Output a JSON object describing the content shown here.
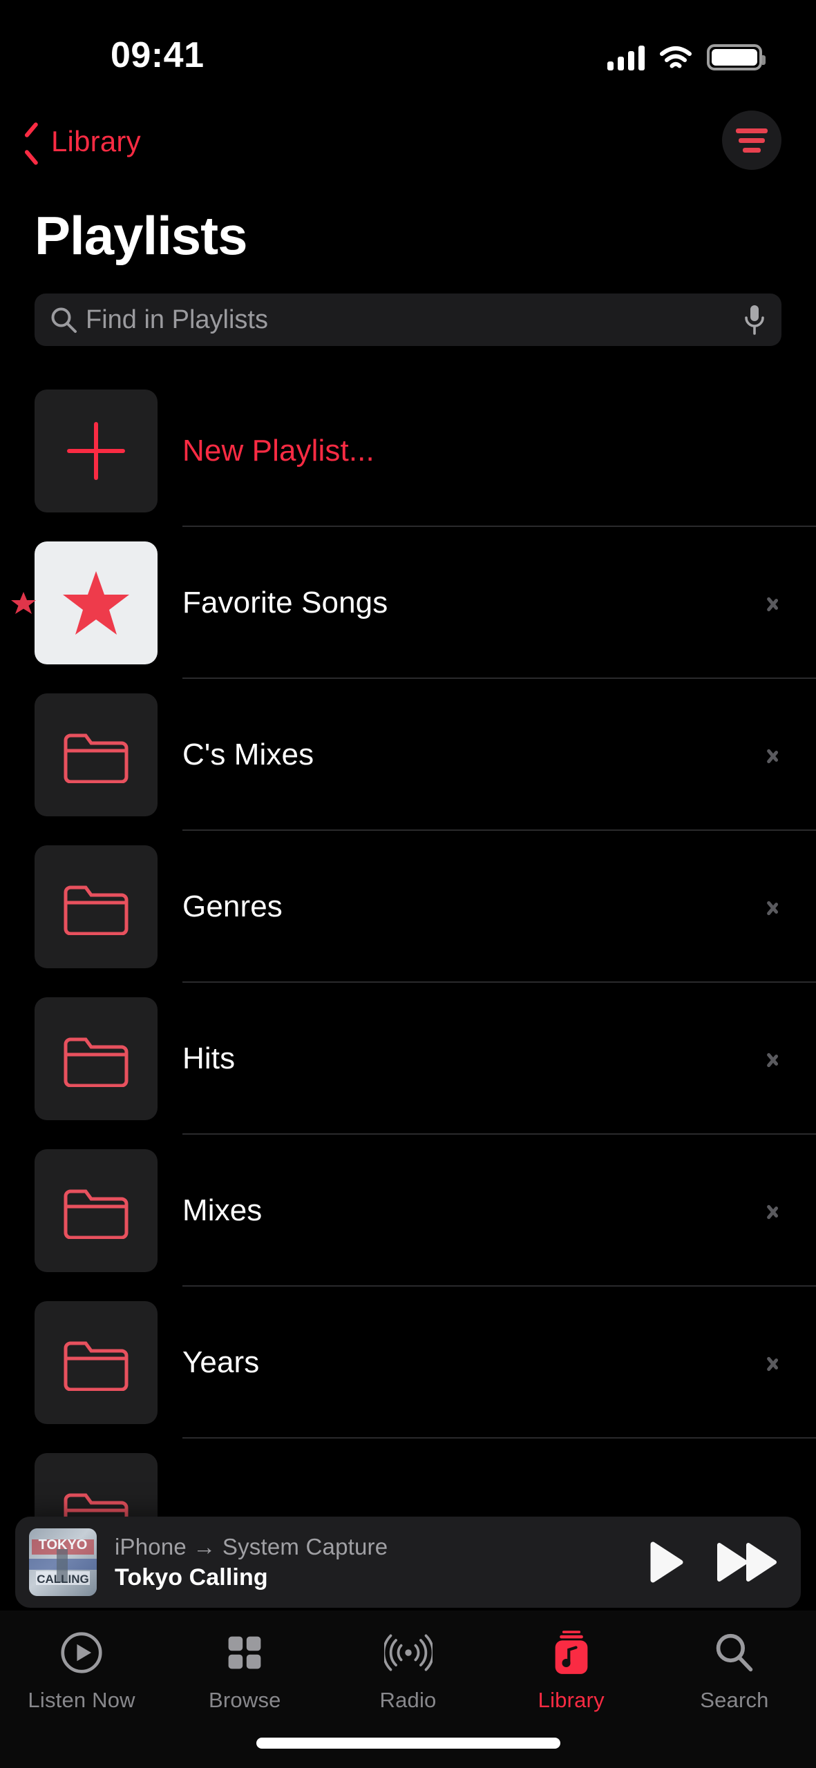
{
  "theme": {
    "accent": "#FA2B43",
    "background": "#000000",
    "tile_bg": "#1f1f20",
    "tile_white": "#eceef0",
    "separator": "#2a2a2c",
    "secondary_text": "#9b9b9f"
  },
  "status_bar": {
    "time": "09:41",
    "cellular_icon": "cellular-signal-icon",
    "wifi_icon": "wifi-icon",
    "battery_icon": "battery-full-icon"
  },
  "nav": {
    "back_label": "Library",
    "back_icon": "chevron-left-icon",
    "filter_icon": "sort-filter-icon"
  },
  "page_title": "Playlists",
  "search": {
    "placeholder": "Find in Playlists",
    "value": "",
    "search_icon": "search-icon",
    "mic_icon": "microphone-icon"
  },
  "list": [
    {
      "label": "New Playlist...",
      "icon": "plus-icon",
      "style": "accent",
      "tile": "dark",
      "chevron": false,
      "edge_marker": false
    },
    {
      "label": "Favorite Songs",
      "icon": "star-icon",
      "style": "normal",
      "tile": "white",
      "chevron": true,
      "edge_marker": true
    },
    {
      "label": "C's Mixes",
      "icon": "folder-icon",
      "style": "normal",
      "tile": "dark",
      "chevron": true,
      "edge_marker": false
    },
    {
      "label": "Genres",
      "icon": "folder-icon",
      "style": "normal",
      "tile": "dark",
      "chevron": true,
      "edge_marker": false
    },
    {
      "label": "Hits",
      "icon": "folder-icon",
      "style": "normal",
      "tile": "dark",
      "chevron": true,
      "edge_marker": false
    },
    {
      "label": "Mixes",
      "icon": "folder-icon",
      "style": "normal",
      "tile": "dark",
      "chevron": true,
      "edge_marker": false
    },
    {
      "label": "Years",
      "icon": "folder-icon",
      "style": "normal",
      "tile": "dark",
      "chevron": true,
      "edge_marker": false
    },
    {
      "label": "",
      "icon": "folder-icon",
      "style": "normal",
      "tile": "dark",
      "chevron": false,
      "edge_marker": false
    }
  ],
  "mini_player": {
    "route": "iPhone → System Capture",
    "title": "Tokyo Calling",
    "artwork_text": "TOKYO CALLING",
    "artwork_name": "album-artwork",
    "play_icon": "play-icon",
    "forward_icon": "fast-forward-icon"
  },
  "tabs": [
    {
      "label": "Listen Now",
      "icon": "play-circle-icon",
      "active": false
    },
    {
      "label": "Browse",
      "icon": "grid-icon",
      "active": false
    },
    {
      "label": "Radio",
      "icon": "radio-waves-icon",
      "active": false
    },
    {
      "label": "Library",
      "icon": "music-library-icon",
      "active": true
    },
    {
      "label": "Search",
      "icon": "search-icon",
      "active": false
    }
  ]
}
